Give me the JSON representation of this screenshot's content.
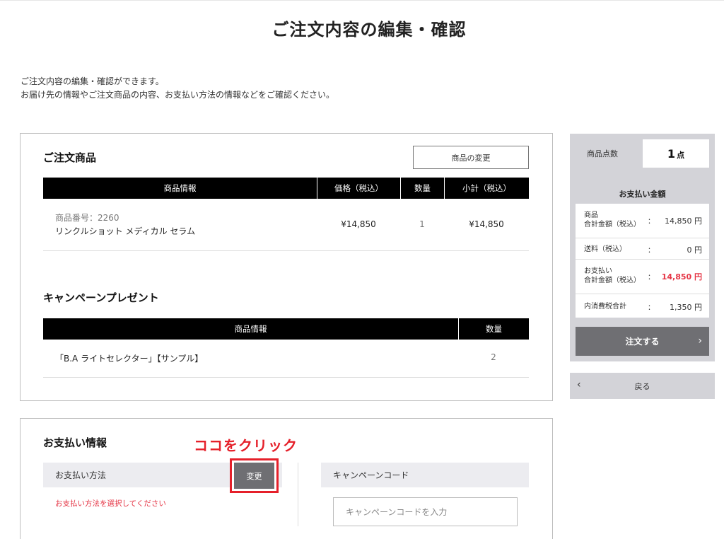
{
  "page": {
    "title": "ご注文内容の編集・確認",
    "intro_line1": "ご注文内容の編集・確認ができます。",
    "intro_line2": "お届け先の情報やご注文商品の内容、お支払い方法の情報などをご確認ください。"
  },
  "order": {
    "title": "ご注文商品",
    "change_button": "商品の変更",
    "headers": [
      "商品情報",
      "価格（税込）",
      "数量",
      "小計（税込）"
    ],
    "items": [
      {
        "number": "商品番号：2260",
        "name": "リンクルショット メディカル セラム",
        "price": "¥14,850",
        "qty": "1",
        "subtotal": "¥14,850"
      }
    ]
  },
  "campaign_present": {
    "title": "キャンペーンプレゼント",
    "headers": [
      "商品情報",
      "数量"
    ],
    "items": [
      {
        "name": "「B.A ライトセレクター」【サンプル】",
        "qty": "2"
      }
    ]
  },
  "sidebar": {
    "count_label": "商品点数",
    "count_value": "1",
    "count_unit": "点",
    "payment_title": "お支払い金額",
    "rows": [
      {
        "label1": "商品",
        "label2": "合計金額（税込）",
        "colon": "：",
        "value": "14,850 円",
        "highlight": false
      },
      {
        "label1": "送料（税込）",
        "label2": "",
        "colon": "：",
        "value": "0 円",
        "highlight": false
      },
      {
        "label1": "お支払い",
        "label2": "合計金額（税込）",
        "colon": "：",
        "value": "14,850 円",
        "highlight": true
      },
      {
        "label1": "内消費税合計",
        "label2": "",
        "colon": "：",
        "value": "1,350 円",
        "highlight": false
      }
    ],
    "order_button": "注文する",
    "back_button": "戻る"
  },
  "payment": {
    "title": "お支払い情報",
    "method_label": "お支払い方法",
    "change_button": "変更",
    "annotation": "ココをクリック",
    "warning": "お支払い方法を選択してください",
    "campaign_code_label": "キャンペーンコード",
    "campaign_code_placeholder": "キャンペーンコードを入力"
  },
  "colors": {
    "accent_red": "#e53545",
    "annotation_red": "#e5202a",
    "button_gray": "#6f6f73",
    "sidebar_gray": "#d3d3d8"
  }
}
